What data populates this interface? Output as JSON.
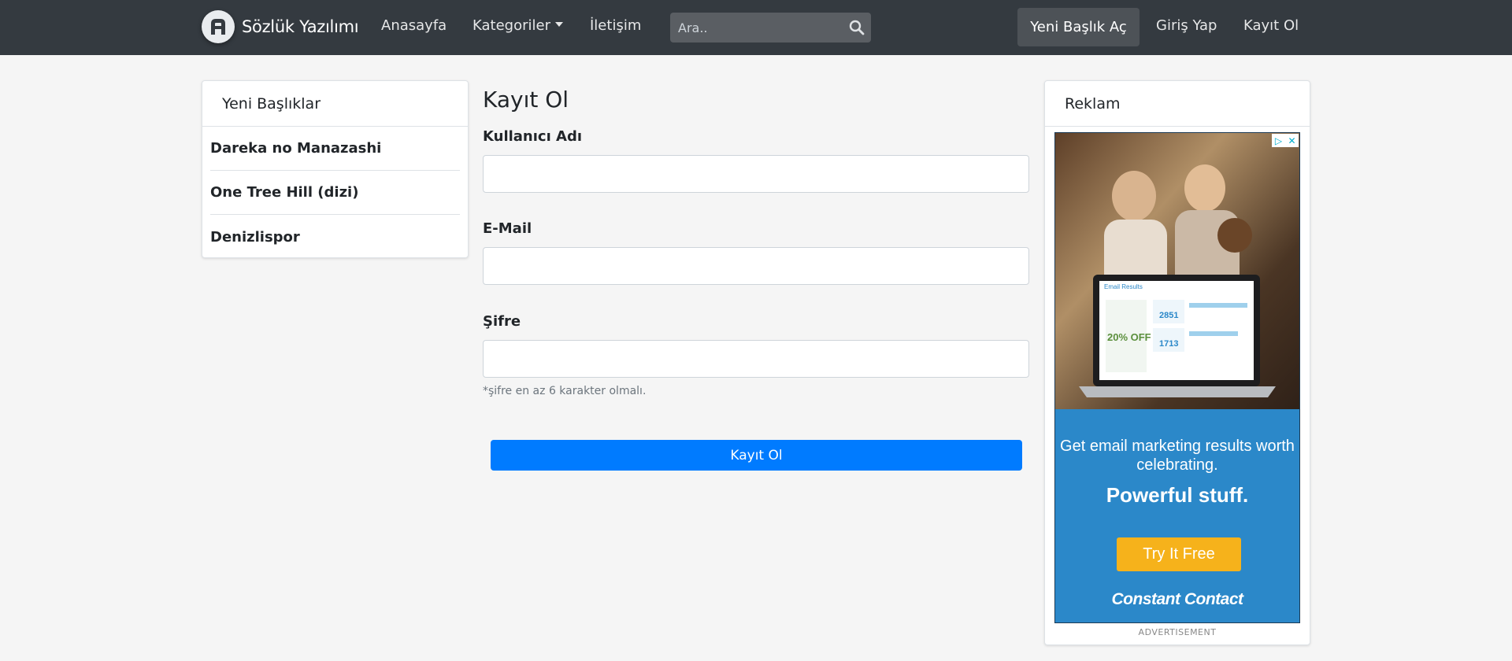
{
  "navbar": {
    "brand": "Sözlük Yazılımı",
    "links": {
      "home": "Anasayfa",
      "categories": "Kategoriler",
      "contact": "İletişim"
    },
    "search_placeholder": "Ara..",
    "new_topic": "Yeni Başlık Aç",
    "login": "Giriş Yap",
    "register": "Kayıt Ol"
  },
  "sidebar": {
    "title": "Yeni Başlıklar",
    "items": [
      "Dareka no Manazashi",
      "One Tree Hill (dizi)",
      "Denizlispor"
    ]
  },
  "form": {
    "title": "Kayıt Ol",
    "username_label": "Kullanıcı Adı",
    "email_label": "E-Mail",
    "password_label": "Şifre",
    "password_hint": "*şifre en az 6 karakter olmalı.",
    "submit": "Kayıt Ol"
  },
  "ad": {
    "title": "Reklam",
    "headline": "Get email marketing results worth celebrating.",
    "tagline": "Powerful stuff.",
    "cta": "Try It Free",
    "brand": "Constant Contact",
    "caption": "ADVERTISEMENT",
    "screen_title": "Email Results",
    "stat1": "2851",
    "stat2": "1713",
    "promo": "20% OFF"
  },
  "colors": {
    "navbar": "#343a40",
    "primary": "#007bff",
    "ad_blue": "#2b88c9",
    "ad_orange": "#f6b21b"
  }
}
